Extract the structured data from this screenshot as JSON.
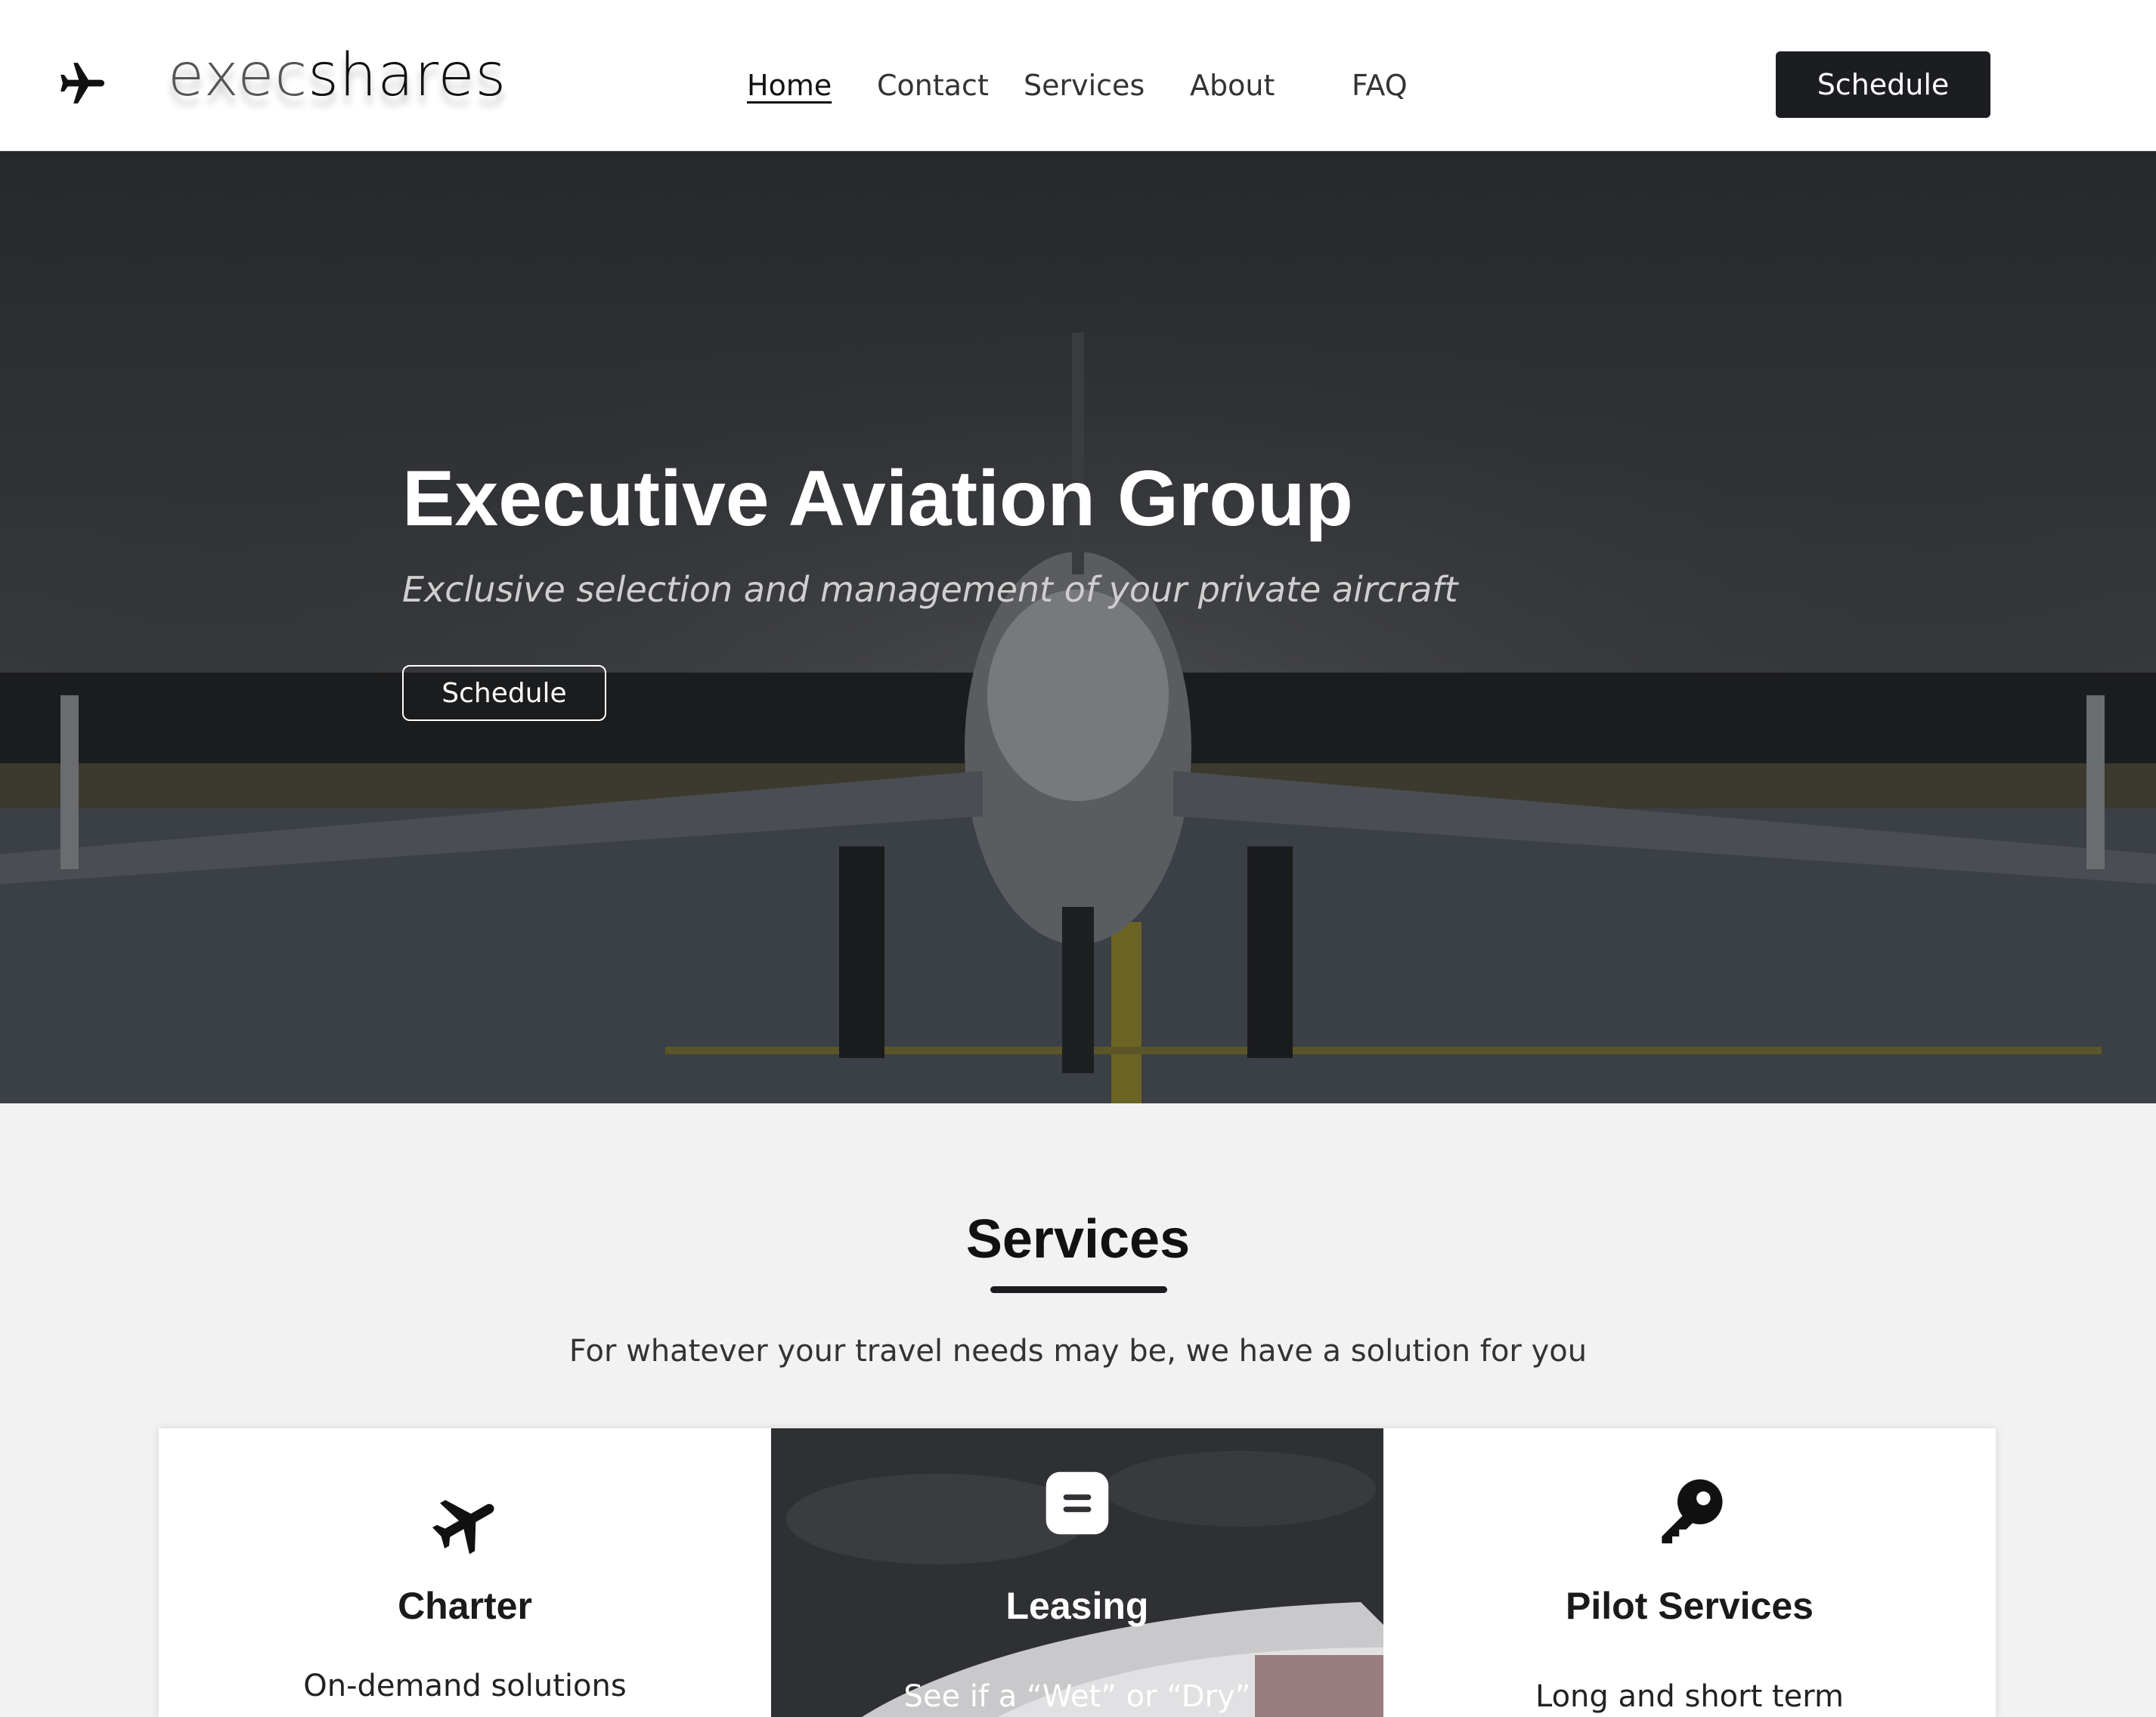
{
  "brand": {
    "name_light": "exec",
    "name_dark": "shares",
    "logo_icon": "airplane-icon"
  },
  "nav": {
    "items": [
      {
        "label": "Home",
        "active": true
      },
      {
        "label": "Contact",
        "active": false
      },
      {
        "label": "Services",
        "active": false
      },
      {
        "label": "About",
        "active": false
      },
      {
        "label": "FAQ",
        "active": false
      }
    ],
    "cta_label": "Schedule"
  },
  "hero": {
    "title": "Executive Aviation Group",
    "subtitle": "Exclusive selection and management of your private aircraft",
    "cta_label": "Schedule"
  },
  "services": {
    "title": "Services",
    "description": "For whatever your travel needs may be, we have a solution for you",
    "cards": [
      {
        "title": "Charter",
        "text": "On-demand solutions",
        "icon": "airplane-icon",
        "style": "light"
      },
      {
        "title": "Leasing",
        "text": "See if a “Wet” or “Dry”",
        "icon": "document-icon",
        "style": "dark"
      },
      {
        "title": "Pilot Services",
        "text": "Long and short term",
        "icon": "key-icon",
        "style": "light"
      }
    ]
  },
  "colors": {
    "header_bg": "#ffffff",
    "button_dark": "#1c1d21",
    "section_bg": "#f2f2f2",
    "hero_overlay": "#2b2d30"
  }
}
